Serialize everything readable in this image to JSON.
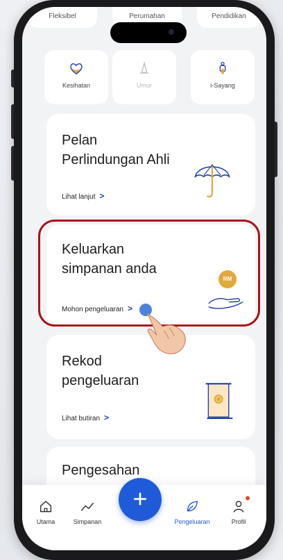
{
  "top_tabs": [
    "Fleksibel",
    "Perumahan",
    "Pendidikan"
  ],
  "categories": [
    {
      "label": "Kesihatan",
      "icon": "heart-icon"
    },
    {
      "label": "Umur",
      "icon": "person-icon"
    },
    {
      "label": "i-Sayang",
      "icon": "family-icon"
    }
  ],
  "cards": [
    {
      "title_line1": "Pelan",
      "title_line2": "Perlindungan Ahli",
      "link": "Lihat lanjut",
      "icon": "umbrella-icon"
    },
    {
      "title_line1": "Keluarkan",
      "title_line2": "simpanan anda",
      "link": "Mohon pengeluaran",
      "icon": "hand-coin-icon",
      "coin_label": "RM"
    },
    {
      "title_line1": "Rekod",
      "title_line2": "pengeluaran",
      "link": "Lihat butiran",
      "icon": "scroll-icon"
    },
    {
      "title_line1": "Pengesahan"
    }
  ],
  "nav": [
    {
      "label": "Utama",
      "icon": "home-icon"
    },
    {
      "label": "Simpanan",
      "icon": "chart-line-icon"
    },
    {
      "label": "Pengeluaran",
      "icon": "leaf-icon",
      "active": true
    },
    {
      "label": "Profil",
      "icon": "person-icon",
      "badge": true
    }
  ],
  "fab_label": "+",
  "colors": {
    "accent": "#1f5bd8",
    "highlight": "#a7141b",
    "gold": "#e2a93c"
  }
}
